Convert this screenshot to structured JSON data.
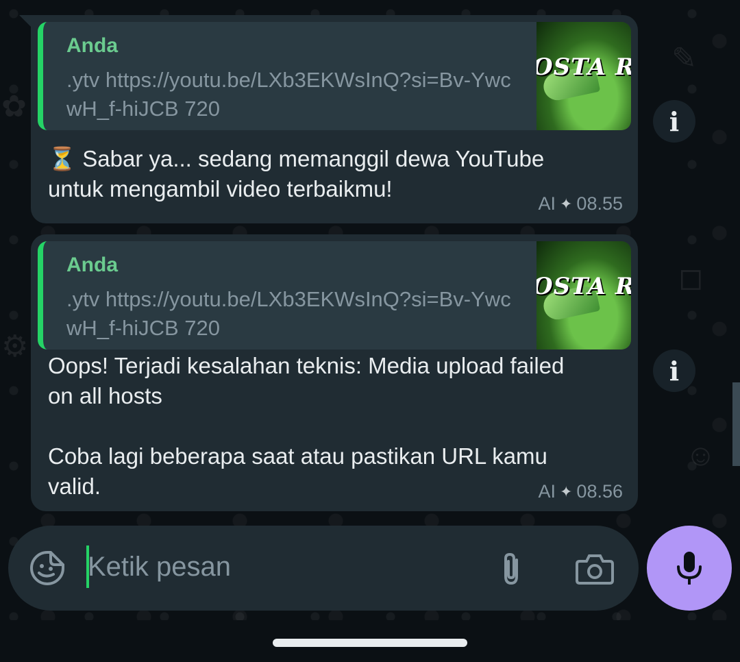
{
  "messages": [
    {
      "quote_author": "Anda",
      "quote_text": ".ytv https://youtu.be/LXb3EKWsInQ?si=Bv-YwcwH_f-hiJCB 720",
      "thumbnail_text": "OSTA RIC",
      "body_icon": "⏳",
      "body_text": " Sabar ya... sedang memanggil dewa YouTube\nuntuk mengambil video terbaikmu!",
      "label": "AI",
      "time": "08.55"
    },
    {
      "quote_author": "Anda",
      "quote_text": ".ytv https://youtu.be/LXb3EKWsInQ?si=Bv-YwcwH_f-hiJCB 720",
      "thumbnail_text": "OSTA RIC",
      "body_text": "Oops! Terjadi kesalahan teknis: Media upload failed\non all hosts\n\nCoba lagi beberapa saat atau pastikan URL kamu\nvalid.",
      "label": "AI",
      "time": "08.56"
    }
  ],
  "info_icon_glyph": "i",
  "composer": {
    "placeholder": "Ketik pesan",
    "icons": [
      "sticker-icon",
      "attach-icon",
      "camera-icon",
      "mic-icon"
    ]
  },
  "colors": {
    "background": "#0b1014",
    "bubble": "#202c33",
    "quote_bar": "#25d366",
    "quote_author": "#6bcb8f",
    "mic_button": "#b196f7"
  }
}
